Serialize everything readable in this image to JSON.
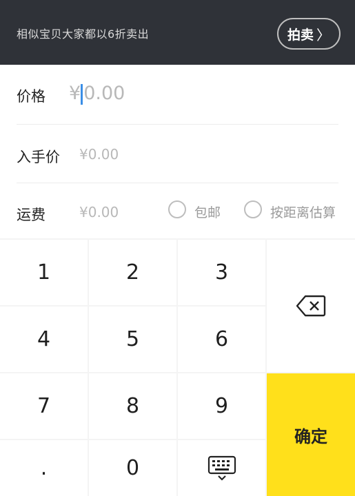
{
  "topbar": {
    "hint": "相似宝贝大家都以6折卖出",
    "auction_button": "拍卖",
    "auction_chevron": "〉"
  },
  "form": {
    "price": {
      "label": "价格",
      "currency": "¥",
      "placeholder": "0.00"
    },
    "buy_price": {
      "label": "入手价",
      "placeholder": "¥0.00"
    },
    "shipping": {
      "label": "运费",
      "placeholder": "¥0.00",
      "options": [
        "包邮",
        "按距离估算"
      ]
    }
  },
  "keypad": {
    "keys": [
      "1",
      "2",
      "3",
      "4",
      "5",
      "6",
      "7",
      "8",
      "9",
      ".",
      "0"
    ],
    "confirm": "确定",
    "backspace_icon": "backspace-icon",
    "keyboard_icon": "keyboard-hide-icon",
    "accent_color": "#ffe01b"
  }
}
